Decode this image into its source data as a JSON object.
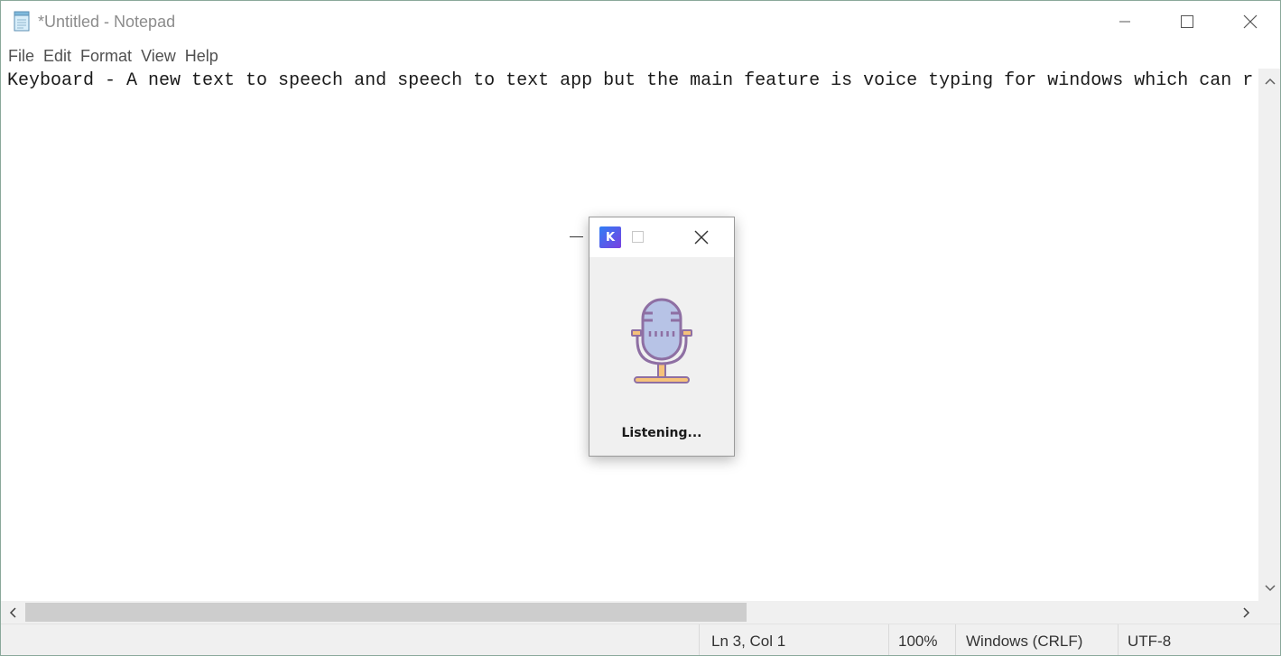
{
  "window": {
    "title": "*Untitled - Notepad",
    "icon": "notepad-icon",
    "controls": [
      "minimize-icon",
      "maximize-icon",
      "close-icon"
    ]
  },
  "menu": {
    "items": [
      "File",
      "Edit",
      "Format",
      "View",
      "Help"
    ]
  },
  "editor": {
    "text": "Keyboard - A new text to speech and speech to text app but the main feature is voice typing for windows which can r"
  },
  "status": {
    "position": "Ln 3, Col 1",
    "zoom": "100%",
    "line_ending": "Windows (CRLF)",
    "encoding": "UTF-8"
  },
  "popup": {
    "logo_letter": "K",
    "status_text": "Listening...",
    "icon": "microphone-icon",
    "colors": {
      "mic_outline": "#8e6fa3",
      "mic_fill": "#b7c3e6",
      "stand": "#f6c27a",
      "logo_start": "#2f7ef5",
      "logo_end": "#7a3fe0"
    }
  }
}
